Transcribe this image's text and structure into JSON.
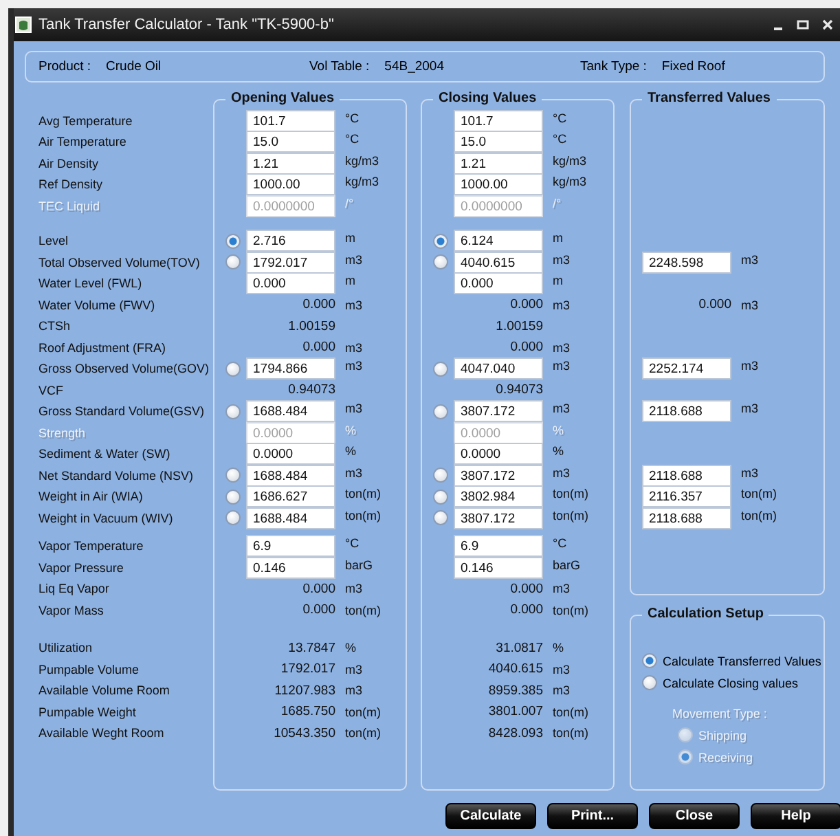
{
  "window": {
    "title": "Tank Transfer Calculator - Tank \"TK-5900-b\""
  },
  "header": [
    {
      "label": "Product :",
      "value": "Crude Oil"
    },
    {
      "label": "Vol Table :",
      "value": "54B_2004"
    },
    {
      "label": "Tank Type :",
      "value": "Fixed Roof"
    }
  ],
  "groups": {
    "opening": "Opening Values",
    "closing": "Closing Values",
    "transferred": "Transferred Values"
  },
  "sections": [
    {
      "rows": [
        {
          "label": "Avg Temperature",
          "disabled": false,
          "opening": {
            "kind": "field",
            "value": "101.7",
            "unit": "°C"
          },
          "closing": {
            "kind": "field",
            "value": "101.7",
            "unit": "°C"
          }
        },
        {
          "label": "Air Temperature",
          "disabled": false,
          "opening": {
            "kind": "field",
            "value": "15.0",
            "unit": "°C"
          },
          "closing": {
            "kind": "field",
            "value": "15.0",
            "unit": "°C"
          }
        },
        {
          "label": "Air Density",
          "disabled": false,
          "opening": {
            "kind": "field",
            "value": "1.21",
            "unit": "kg/m3"
          },
          "closing": {
            "kind": "field",
            "value": "1.21",
            "unit": "kg/m3"
          }
        },
        {
          "label": "Ref Density",
          "disabled": false,
          "opening": {
            "kind": "field",
            "value": "1000.00",
            "unit": "kg/m3"
          },
          "closing": {
            "kind": "field",
            "value": "1000.00",
            "unit": "kg/m3"
          }
        },
        {
          "label": "TEC Liquid",
          "disabled": true,
          "opening": {
            "kind": "field",
            "value": "0.0000000",
            "unit": "/°"
          },
          "closing": {
            "kind": "field",
            "value": "0.0000000",
            "unit": "/°"
          }
        }
      ]
    },
    {
      "rows": [
        {
          "label": "Level",
          "disabled": false,
          "opening": {
            "kind": "radio-field",
            "selected": true,
            "value": "2.716",
            "unit": "m"
          },
          "closing": {
            "kind": "radio-field",
            "selected": true,
            "value": "6.124",
            "unit": "m"
          }
        },
        {
          "label": "Total Observed Volume(TOV)",
          "disabled": false,
          "opening": {
            "kind": "radio-field",
            "selected": false,
            "value": "1792.017",
            "unit": "m3"
          },
          "closing": {
            "kind": "radio-field",
            "selected": false,
            "value": "4040.615",
            "unit": "m3"
          },
          "transferred": {
            "kind": "field",
            "value": "2248.598",
            "unit": "m3"
          }
        },
        {
          "label": "Water Level (FWL)",
          "disabled": false,
          "opening": {
            "kind": "field",
            "value": "0.000",
            "unit": "m"
          },
          "closing": {
            "kind": "field",
            "value": "0.000",
            "unit": "m"
          }
        },
        {
          "label": "Water Volume (FWV)",
          "disabled": false,
          "opening": {
            "kind": "value",
            "value": "0.000",
            "unit": "m3"
          },
          "closing": {
            "kind": "value",
            "value": "0.000",
            "unit": "m3"
          },
          "transferred": {
            "kind": "value",
            "value": "0.000",
            "unit": "m3"
          }
        },
        {
          "label": "CTSh",
          "disabled": false,
          "opening": {
            "kind": "value",
            "value": "1.00159"
          },
          "closing": {
            "kind": "value",
            "value": "1.00159"
          }
        },
        {
          "label": "Roof Adjustment (FRA)",
          "disabled": false,
          "opening": {
            "kind": "value",
            "value": "0.000",
            "unit": "m3"
          },
          "closing": {
            "kind": "value",
            "value": "0.000",
            "unit": "m3"
          }
        },
        {
          "label": "Gross Observed Volume(GOV)",
          "disabled": false,
          "opening": {
            "kind": "radio-field",
            "selected": false,
            "value": "1794.866",
            "unit": "m3"
          },
          "closing": {
            "kind": "radio-field",
            "selected": false,
            "value": "4047.040",
            "unit": "m3"
          },
          "transferred": {
            "kind": "field",
            "value": "2252.174",
            "unit": "m3"
          }
        },
        {
          "label": "VCF",
          "disabled": false,
          "opening": {
            "kind": "value",
            "value": "0.94073"
          },
          "closing": {
            "kind": "value",
            "value": "0.94073"
          }
        },
        {
          "label": "Gross Standard Volume(GSV)",
          "disabled": false,
          "opening": {
            "kind": "radio-field",
            "selected": false,
            "value": "1688.484",
            "unit": "m3"
          },
          "closing": {
            "kind": "radio-field",
            "selected": false,
            "value": "3807.172",
            "unit": "m3"
          },
          "transferred": {
            "kind": "field",
            "value": "2118.688",
            "unit": "m3"
          }
        },
        {
          "label": "Strength",
          "disabled": true,
          "opening": {
            "kind": "field",
            "value": "0.0000",
            "unit": "%"
          },
          "closing": {
            "kind": "field",
            "value": "0.0000",
            "unit": "%"
          }
        },
        {
          "label": "Sediment & Water (SW)",
          "disabled": false,
          "opening": {
            "kind": "field",
            "value": "0.0000",
            "unit": "%"
          },
          "closing": {
            "kind": "field",
            "value": "0.0000",
            "unit": "%"
          }
        },
        {
          "label": "Net Standard Volume (NSV)",
          "disabled": false,
          "opening": {
            "kind": "radio-field",
            "selected": false,
            "value": "1688.484",
            "unit": "m3"
          },
          "closing": {
            "kind": "radio-field",
            "selected": false,
            "value": "3807.172",
            "unit": "m3"
          },
          "transferred": {
            "kind": "field",
            "value": "2118.688",
            "unit": "m3"
          }
        },
        {
          "label": "Weight in Air (WIA)",
          "disabled": false,
          "opening": {
            "kind": "radio-field",
            "selected": false,
            "value": "1686.627",
            "unit": "ton(m)"
          },
          "closing": {
            "kind": "radio-field",
            "selected": false,
            "value": "3802.984",
            "unit": "ton(m)"
          },
          "transferred": {
            "kind": "field",
            "value": "2116.357",
            "unit": "ton(m)"
          }
        },
        {
          "label": "Weight in Vacuum (WIV)",
          "disabled": false,
          "opening": {
            "kind": "radio-field",
            "selected": false,
            "value": "1688.484",
            "unit": "ton(m)"
          },
          "closing": {
            "kind": "radio-field",
            "selected": false,
            "value": "3807.172",
            "unit": "ton(m)"
          },
          "transferred": {
            "kind": "field",
            "value": "2118.688",
            "unit": "ton(m)"
          }
        }
      ]
    },
    {
      "rows": [
        {
          "label": "Vapor Temperature",
          "disabled": false,
          "opening": {
            "kind": "field",
            "value": "6.9",
            "unit": "°C"
          },
          "closing": {
            "kind": "field",
            "value": "6.9",
            "unit": "°C"
          }
        },
        {
          "label": "Vapor Pressure",
          "disabled": false,
          "opening": {
            "kind": "field",
            "value": "0.146",
            "unit": "barG"
          },
          "closing": {
            "kind": "field",
            "value": "0.146",
            "unit": "barG"
          }
        },
        {
          "label": "Liq Eq Vapor",
          "disabled": false,
          "opening": {
            "kind": "value",
            "value": "0.000",
            "unit": "m3"
          },
          "closing": {
            "kind": "value",
            "value": "0.000",
            "unit": "m3"
          }
        },
        {
          "label": "Vapor Mass",
          "disabled": false,
          "opening": {
            "kind": "value",
            "value": "0.000",
            "unit": "ton(m)"
          },
          "closing": {
            "kind": "value",
            "value": "0.000",
            "unit": "ton(m)"
          }
        }
      ]
    },
    {
      "rows": [
        {
          "label": "Utilization",
          "disabled": false,
          "opening": {
            "kind": "value",
            "value": "13.7847",
            "unit": "%"
          },
          "closing": {
            "kind": "value",
            "value": "31.0817",
            "unit": "%"
          }
        },
        {
          "label": "Pumpable Volume",
          "disabled": false,
          "opening": {
            "kind": "value",
            "value": "1792.017",
            "unit": "m3"
          },
          "closing": {
            "kind": "value",
            "value": "4040.615",
            "unit": "m3"
          }
        },
        {
          "label": "Available Volume Room",
          "disabled": false,
          "opening": {
            "kind": "value",
            "value": "11207.983",
            "unit": "m3"
          },
          "closing": {
            "kind": "value",
            "value": "8959.385",
            "unit": "m3"
          }
        },
        {
          "label": "Pumpable Weight",
          "disabled": false,
          "opening": {
            "kind": "value",
            "value": "1685.750",
            "unit": "ton(m)"
          },
          "closing": {
            "kind": "value",
            "value": "3801.007",
            "unit": "ton(m)"
          }
        },
        {
          "label": "Available Weght Room",
          "disabled": false,
          "opening": {
            "kind": "value",
            "value": "10543.350",
            "unit": "ton(m)"
          },
          "closing": {
            "kind": "value",
            "value": "8428.093",
            "unit": "ton(m)"
          }
        }
      ]
    }
  ],
  "calculation_setup": {
    "title": "Calculation Setup",
    "options": [
      {
        "label": "Calculate Transferred Values",
        "selected": true
      },
      {
        "label": "Calculate Closing values",
        "selected": false
      }
    ],
    "movement_type": {
      "label": "Movement Type :",
      "disabled": true,
      "options": [
        {
          "label": "Shipping",
          "selected": false
        },
        {
          "label": "Receiving",
          "selected": true
        }
      ]
    }
  },
  "buttons": [
    "Calculate",
    "Print...",
    "Close",
    "Help"
  ]
}
